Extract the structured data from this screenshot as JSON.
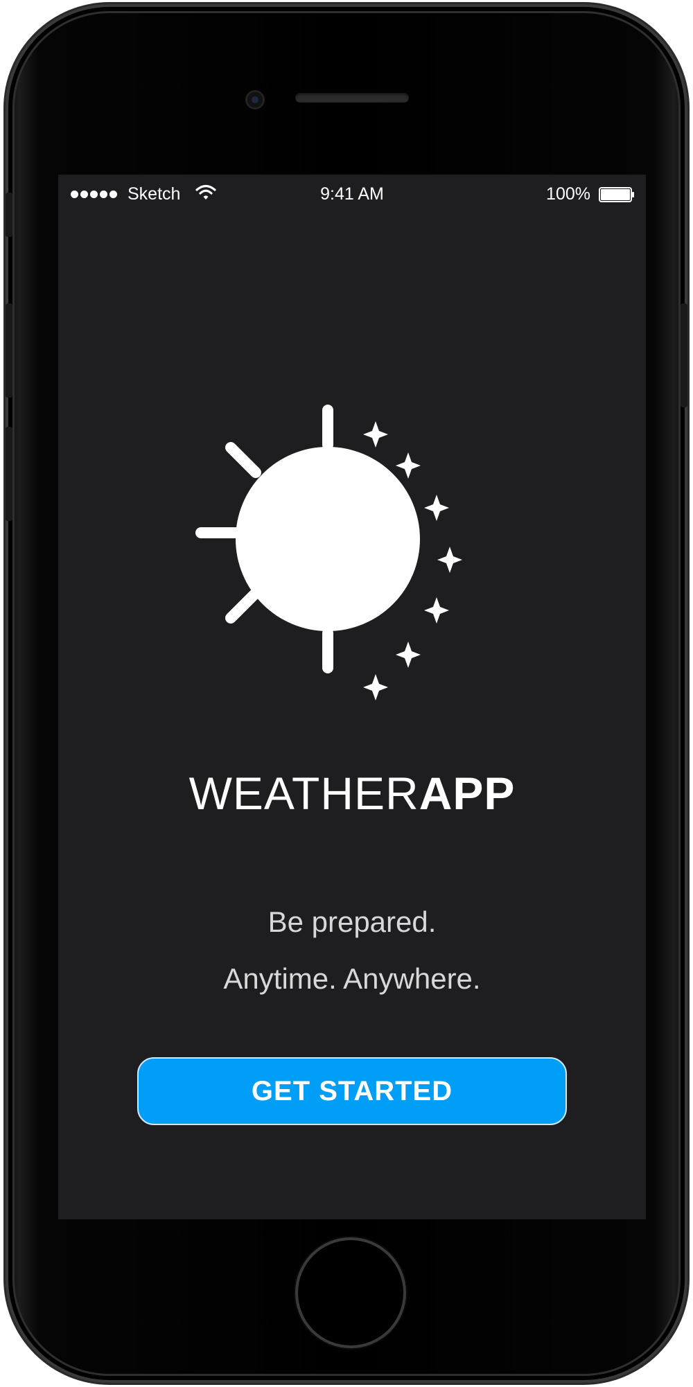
{
  "status_bar": {
    "carrier": "Sketch",
    "time": "9:41 AM",
    "battery_percent": "100%",
    "signal_bars": 5,
    "wifi_icon": "wifi-icon",
    "battery_icon": "battery-icon"
  },
  "logo": {
    "icon": "sun-icon",
    "title_light": "WEATHER",
    "title_bold": "APP"
  },
  "tagline": {
    "line1": "Be prepared.",
    "line2": "Anytime. Anywhere."
  },
  "cta": {
    "label": "GET STARTED",
    "color": "#009ef7"
  },
  "colors": {
    "screen_background": "#1e1e20",
    "text": "#ffffff"
  }
}
